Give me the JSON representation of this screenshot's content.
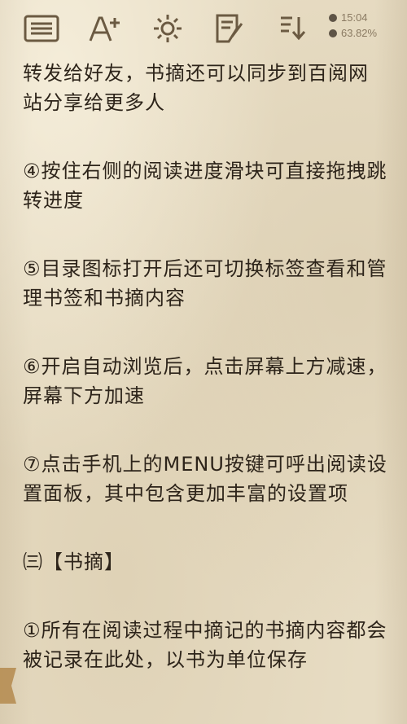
{
  "toolbar": {
    "icons": [
      "toc-icon",
      "font-size-icon",
      "brightness-icon",
      "notes-icon",
      "download-icon"
    ]
  },
  "status": {
    "time": "15:04",
    "battery": "63.82%"
  },
  "content": {
    "paragraphs": [
      "转发给好友，书摘还可以同步到百阅网站分享给更多人",
      "④按住右侧的阅读进度滑块可直接拖拽跳转进度",
      "⑤目录图标打开后还可切换标签查看和管理书签和书摘内容",
      "⑥开启自动浏览后，点击屏幕上方减速，屏幕下方加速",
      "⑦点击手机上的MENU按键可呼出阅读设置面板，其中包含更加丰富的设置项",
      "㈢【书摘】",
      "①所有在阅读过程中摘记的书摘内容都会被记录在此处，以书为单位保存"
    ]
  },
  "colors": {
    "page": "#e7dcc3",
    "text": "#2d241a",
    "icon": "#6b5a42",
    "bookmark": "#b48a4d"
  }
}
